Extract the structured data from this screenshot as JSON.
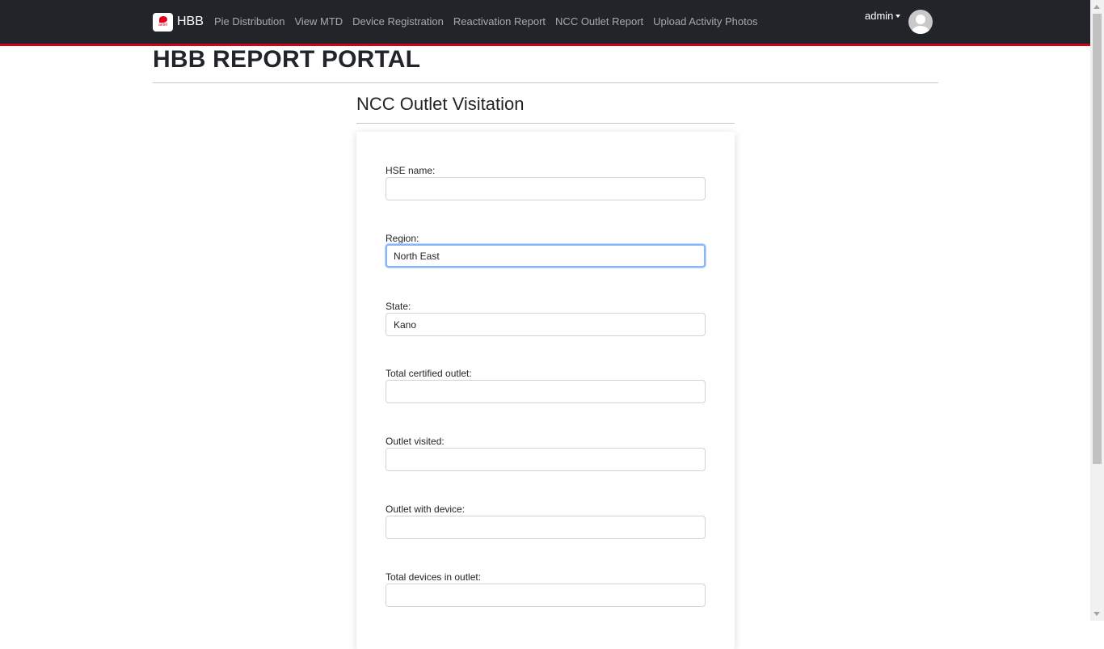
{
  "navbar": {
    "brand_name": "HBB",
    "brand_logo_text": "airtel",
    "links": [
      "Pie Distribution",
      "View MTD",
      "Device Registration",
      "Reactivation Report",
      "NCC Outlet Report",
      "Upload Activity Photos"
    ],
    "user_label": "admin"
  },
  "page": {
    "title": "HBB REPORT PORTAL"
  },
  "form": {
    "title": "NCC Outlet Visitation",
    "fields": [
      {
        "label": "HSE name:",
        "value": ""
      },
      {
        "label": "Region:",
        "value": "North East"
      },
      {
        "label": "State:",
        "value": "Kano"
      },
      {
        "label": "Total certified outlet:",
        "value": ""
      },
      {
        "label": "Outlet visited:",
        "value": ""
      },
      {
        "label": "Outlet with device:",
        "value": ""
      },
      {
        "label": "Total devices in outlet:",
        "value": ""
      }
    ]
  },
  "colors": {
    "navbar_bg": "#212529",
    "navbar_accent": "#d0021b",
    "focus_ring": "#86b7fe"
  }
}
